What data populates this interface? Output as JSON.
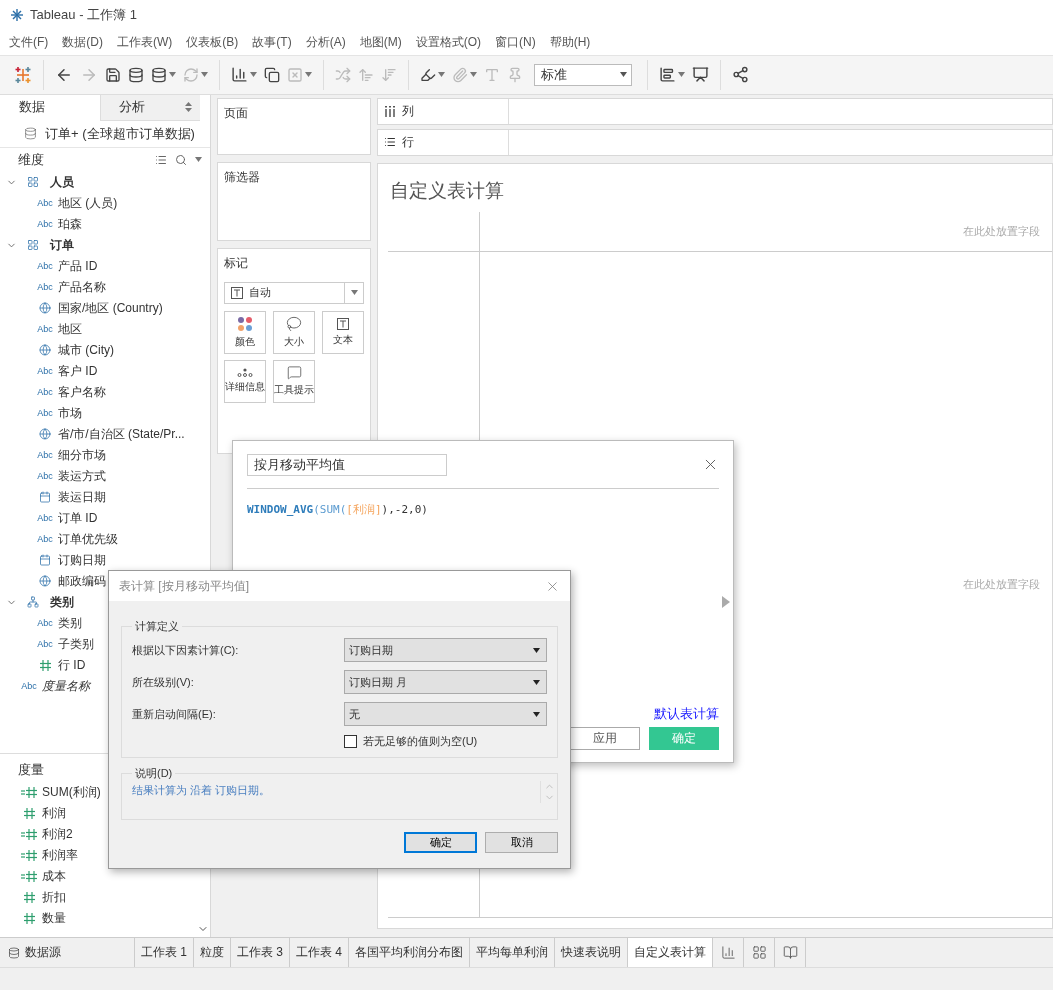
{
  "window": {
    "title": "Tableau - 工作簿 1"
  },
  "menu": [
    "文件(F)",
    "数据(D)",
    "工作表(W)",
    "仪表板(B)",
    "故事(T)",
    "分析(A)",
    "地图(M)",
    "设置格式(O)",
    "窗口(N)",
    "帮助(H)"
  ],
  "toolbar": {
    "mark_select": "标准"
  },
  "data_pane": {
    "tabs": [
      {
        "label": "数据",
        "selected": true
      },
      {
        "label": "分析",
        "selected": false
      }
    ],
    "data_source": "订单+ (全球超市订单数据)",
    "dimensions": {
      "title": "维度",
      "items": [
        {
          "label": "人员",
          "kind": "table",
          "expanded": true,
          "children": [
            {
              "label": "地区 (人员)",
              "kind": "string",
              "badge": "Abc"
            },
            {
              "label": "珀森",
              "kind": "string",
              "badge": "Abc"
            }
          ]
        },
        {
          "label": "订单",
          "kind": "table",
          "expanded": true,
          "children": [
            {
              "label": "产品 ID",
              "kind": "string",
              "badge": "Abc"
            },
            {
              "label": "产品名称",
              "kind": "string",
              "badge": "Abc"
            },
            {
              "label": "国家/地区 (Country)",
              "kind": "geo"
            },
            {
              "label": "地区",
              "kind": "string",
              "badge": "Abc"
            },
            {
              "label": "城市 (City)",
              "kind": "geo"
            },
            {
              "label": "客户 ID",
              "kind": "string",
              "badge": "Abc"
            },
            {
              "label": "客户名称",
              "kind": "string",
              "badge": "Abc"
            },
            {
              "label": "市场",
              "kind": "string",
              "badge": "Abc"
            },
            {
              "label": "省/市/自治区 (State/Pr...",
              "kind": "geo"
            },
            {
              "label": "细分市场",
              "kind": "string",
              "badge": "Abc"
            },
            {
              "label": "装运方式",
              "kind": "string",
              "badge": "Abc"
            },
            {
              "label": "装运日期",
              "kind": "date"
            },
            {
              "label": "订单 ID",
              "kind": "string",
              "badge": "Abc"
            },
            {
              "label": "订单优先级",
              "kind": "string",
              "badge": "Abc"
            },
            {
              "label": "订购日期",
              "kind": "date"
            },
            {
              "label": "邮政编码",
              "kind": "geo"
            }
          ]
        },
        {
          "label": "类别",
          "kind": "hierarchy",
          "expanded": true,
          "children": [
            {
              "label": "类别",
              "kind": "string",
              "badge": "Abc"
            },
            {
              "label": "子类别",
              "kind": "string",
              "badge": "Abc"
            },
            {
              "label": "行 ID",
              "kind": "number"
            }
          ]
        },
        {
          "label": "度量名称",
          "kind": "names",
          "badge": "Abc"
        }
      ]
    },
    "measures": {
      "title": "度量",
      "items": [
        {
          "label": "SUM(利润)",
          "kind": "calc"
        },
        {
          "label": "利润",
          "kind": "number"
        },
        {
          "label": "利润2",
          "kind": "calc"
        },
        {
          "label": "利润率",
          "kind": "calc"
        },
        {
          "label": "成本",
          "kind": "calc"
        },
        {
          "label": "折扣",
          "kind": "number"
        },
        {
          "label": "数量",
          "kind": "number"
        }
      ]
    }
  },
  "shelves": {
    "pages": "页面",
    "filters": "筛选器",
    "columns": "列",
    "rows": "行",
    "marks": {
      "title": "标记",
      "mark_type": "自动",
      "cards": [
        {
          "label": "颜色",
          "kind": "color"
        },
        {
          "label": "大小",
          "kind": "size"
        },
        {
          "label": "文本",
          "kind": "text"
        },
        {
          "label": "详细信息",
          "kind": "detail"
        },
        {
          "label": "工具提示",
          "kind": "tooltip"
        }
      ]
    }
  },
  "sheet": {
    "title": "自定义表计算",
    "drop_hints": [
      "在此处放置字段",
      "在此处放置字段"
    ]
  },
  "calc_editor": {
    "name": "按月移动平均值",
    "formula": [
      {
        "text": "WINDOW_AVG",
        "kind": "function"
      },
      {
        "text": "(SUM(",
        "kind": "function_light"
      },
      {
        "text": "[利润]",
        "kind": "field"
      },
      {
        "text": "),-2,0)",
        "kind": "plain"
      }
    ],
    "link": "默认表计算",
    "buttons": [
      {
        "label": "应用",
        "primary": false
      },
      {
        "label": "确定",
        "primary": true
      }
    ]
  },
  "table_calc": {
    "title": "表计算 [按月移动平均值]",
    "group": "计算定义",
    "rows": [
      {
        "label": "根据以下因素计算(C):",
        "value": "订购日期"
      },
      {
        "label": "所在级别(V):",
        "value": "订购日期 月"
      },
      {
        "label": "重新启动间隔(E):",
        "value": "无"
      }
    ],
    "checkbox": {
      "label": "若无足够的值则为空(U)",
      "checked": false
    },
    "description": {
      "title": "说明(D)",
      "text": "结果计算为 沿着 订购日期。"
    },
    "buttons": [
      {
        "label": "确定",
        "focused": true
      },
      {
        "label": "取消",
        "focused": false
      }
    ]
  },
  "sheet_tabs": {
    "data_source": "数据源",
    "tabs": [
      {
        "label": "工作表 1",
        "selected": false
      },
      {
        "label": "粒度",
        "selected": false
      },
      {
        "label": "工作表 3",
        "selected": false
      },
      {
        "label": "工作表 4",
        "selected": false
      },
      {
        "label": "各国平均利润分布图",
        "selected": false
      },
      {
        "label": "平均每单利润",
        "selected": false
      },
      {
        "label": "快速表说明",
        "selected": false
      },
      {
        "label": "自定义表计算",
        "selected": true
      }
    ]
  }
}
